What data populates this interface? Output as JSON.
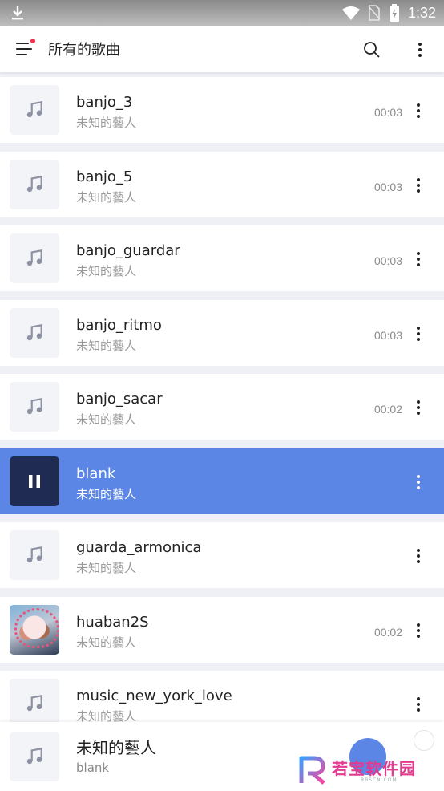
{
  "status_bar": {
    "time": "1:32"
  },
  "app_bar": {
    "title": "所有的歌曲"
  },
  "songs": [
    {
      "name": "banjo_3",
      "artist": "未知的藝人",
      "duration": "00:03",
      "active": false,
      "art": "music-note"
    },
    {
      "name": "banjo_5",
      "artist": "未知的藝人",
      "duration": "00:03",
      "active": false,
      "art": "music-note"
    },
    {
      "name": "banjo_guardar",
      "artist": "未知的藝人",
      "duration": "00:03",
      "active": false,
      "art": "music-note"
    },
    {
      "name": "banjo_ritmo",
      "artist": "未知的藝人",
      "duration": "00:03",
      "active": false,
      "art": "music-note"
    },
    {
      "name": "banjo_sacar",
      "artist": "未知的藝人",
      "duration": "00:02",
      "active": false,
      "art": "music-note"
    },
    {
      "name": "blank",
      "artist": "未知的藝人",
      "duration": "",
      "active": true,
      "art": "pause"
    },
    {
      "name": "guarda_armonica",
      "artist": "未知的藝人",
      "duration": "",
      "active": false,
      "art": "music-note"
    },
    {
      "name": "huaban2S",
      "artist": "未知的藝人",
      "duration": "00:02",
      "active": false,
      "art": "photo"
    },
    {
      "name": "music_new_york_love",
      "artist": "未知的藝人",
      "duration": "",
      "active": false,
      "art": "music-note"
    }
  ],
  "now_playing": {
    "title": "未知的藝人",
    "subtitle": "blank"
  },
  "watermark": {
    "text": "若宝软件园",
    "subtext": "RBSCN.COM"
  },
  "colors": {
    "accent": "#5b86e5",
    "active_thumb": "#1f2b52",
    "notification_dot": "#f0324b"
  }
}
